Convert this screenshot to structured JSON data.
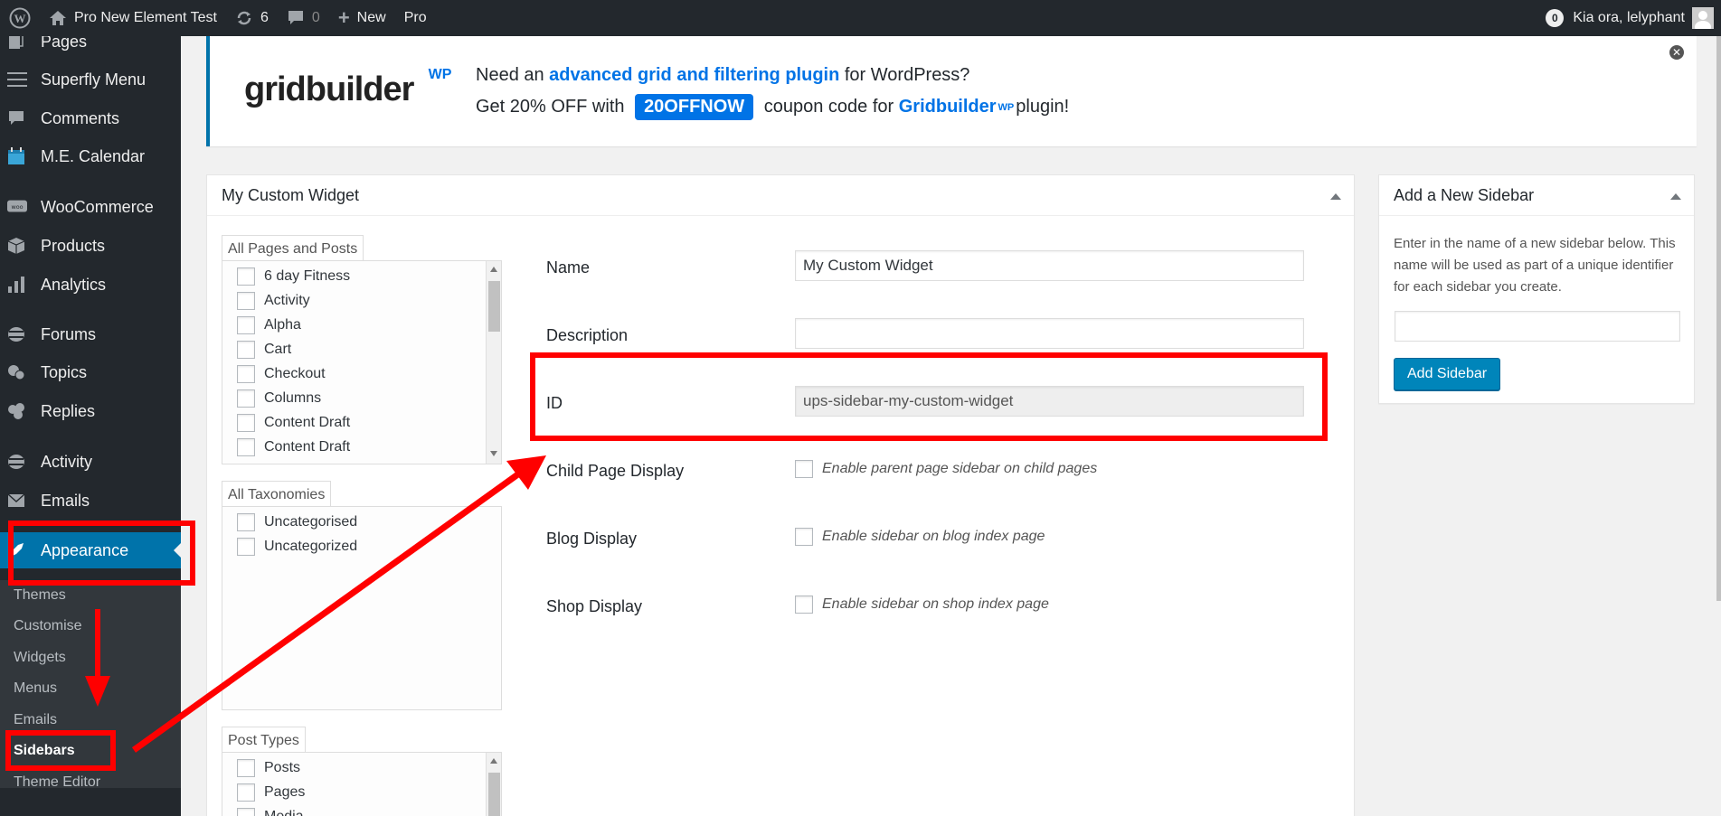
{
  "adminbar": {
    "site_name": "Pro New Element Test",
    "updates_count": "6",
    "comments_count": "0",
    "new_label": "New",
    "pro_label": "Pro",
    "notifications_count": "0",
    "greeting": "Kia ora, lelyphant"
  },
  "menu": {
    "items": [
      {
        "label": "Pages",
        "icon": "pages-icon"
      },
      {
        "label": "Superfly Menu",
        "icon": "menu-lines-icon"
      },
      {
        "label": "Comments",
        "icon": "comment-icon"
      },
      {
        "label": "M.E. Calendar",
        "icon": "calendar-icon"
      },
      {
        "label": "WooCommerce",
        "icon": "woo-icon"
      },
      {
        "label": "Products",
        "icon": "box-icon"
      },
      {
        "label": "Analytics",
        "icon": "bar-chart-icon"
      },
      {
        "label": "Forums",
        "icon": "forums-icon"
      },
      {
        "label": "Topics",
        "icon": "topics-icon"
      },
      {
        "label": "Replies",
        "icon": "replies-icon"
      },
      {
        "label": "Activity",
        "icon": "activity-icon"
      },
      {
        "label": "Emails",
        "icon": "mail-icon"
      },
      {
        "label": "Appearance",
        "icon": "brush-icon"
      }
    ],
    "submenu": [
      "Themes",
      "Customise",
      "Widgets",
      "Menus",
      "Emails",
      "Sidebars",
      "Theme Editor"
    ]
  },
  "banner": {
    "logo_text": "gridbuilder",
    "logo_sup": "WP",
    "line1_prefix": "Need an ",
    "line1_link": "advanced grid and filtering plugin",
    "line1_suffix": " for WordPress?",
    "line2_prefix": "Get 20% OFF with ",
    "coupon": "20OFFNOW",
    "line2_mid": " coupon code for ",
    "line2_brand": "Gridbuilder",
    "line2_brand_sup": "WP",
    "line2_suffix": " plugin!"
  },
  "widget_box": {
    "title": "My Custom Widget",
    "pages_tab": "All Pages and Posts",
    "pages": [
      "6 day Fitness",
      "Activity",
      "Alpha",
      "Cart",
      "Checkout",
      "Columns",
      "Content Draft",
      "Content Draft"
    ],
    "taxonomies_tab": "All Taxonomies",
    "taxonomies": [
      "Uncategorised",
      "Uncategorized"
    ],
    "post_types_tab": "Post Types",
    "post_types": [
      "Posts",
      "Pages",
      "Media"
    ],
    "fields": {
      "name_label": "Name",
      "name_value": "My Custom Widget",
      "description_label": "Description",
      "description_value": "",
      "id_label": "ID",
      "id_value": "ups-sidebar-my-custom-widget",
      "child_label": "Child Page Display",
      "child_option": "Enable parent page sidebar on child pages",
      "blog_label": "Blog Display",
      "blog_option": "Enable sidebar on blog index page",
      "shop_label": "Shop Display",
      "shop_option": "Enable sidebar on shop index page"
    }
  },
  "new_sidebar_box": {
    "title": "Add a New Sidebar",
    "description": "Enter in the name of a new sidebar below. This name will be used as part of a unique identifier for each sidebar you create.",
    "input_value": "",
    "button_label": "Add Sidebar"
  },
  "colors": {
    "admin_dark": "#23282d",
    "accent": "#0073aa",
    "annotation": "#ff0000",
    "brand_blue": "#0073e6"
  }
}
